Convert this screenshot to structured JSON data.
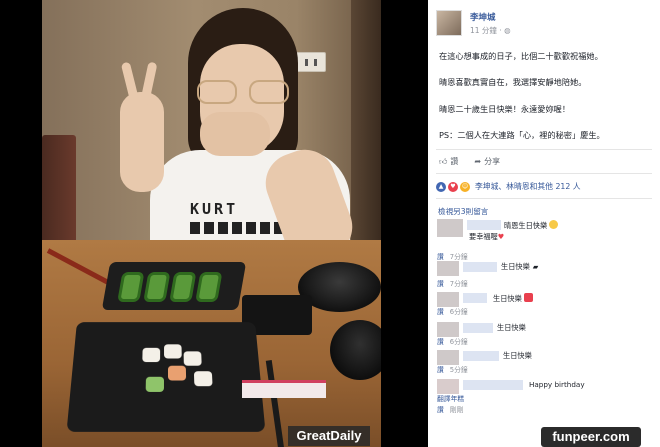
{
  "photo": {
    "shirt_text": "KURT",
    "watermark": "GreatDaily"
  },
  "post": {
    "author": "李坤城",
    "time": "11 分鐘",
    "privacy_icon": "globe-icon",
    "paragraphs": [
      "在這心想事成的日子，比個二十歡歡祝福她。",
      "晴恩喜歡真實自在，我選擇安靜地陪她。",
      "晴恩二十歲生日快樂！永遠愛妳喔！",
      "PS：二個人在大連路「心，裡的秘密」慶生。"
    ],
    "like_label": "讚",
    "share_label": "分享",
    "reactions_text": "李坤城、林晴恩和其他 212 人",
    "reaction_colors": [
      "#4267b2",
      "#e9404e",
      "#f7b125"
    ]
  },
  "comments_header": "檢視另3則留言",
  "comments": [
    {
      "text": "晴恩生日快樂",
      "emoji": "smile-emoji",
      "second_line": "要幸福喔",
      "heart": true,
      "sub_action": "",
      "time": ""
    },
    {
      "text": "",
      "emoji": "",
      "second_line": "",
      "heart": false,
      "sub_action": "讚",
      "time": "7分鐘"
    },
    {
      "text": "生日快樂",
      "emoji": "cake-emoji",
      "second_line": "",
      "heart": false,
      "sub_action": "讚",
      "time": "7分鐘"
    },
    {
      "text": "生日快樂",
      "emoji": "gift-emoji",
      "second_line": "",
      "heart": false,
      "sub_action": "讚",
      "time": "6分鐘"
    },
    {
      "text": "生日快樂",
      "emoji": "",
      "second_line": "",
      "heart": false,
      "sub_action": "讚",
      "time": "6分鐘"
    },
    {
      "text": "生日快樂",
      "emoji": "",
      "second_line": "",
      "heart": false,
      "sub_action": "讚",
      "time": "5分鐘"
    },
    {
      "text": "Happy birthday",
      "emoji": "",
      "second_line": "",
      "heart": false,
      "sub_action": "翻譯年糕",
      "time": ""
    },
    {
      "text": "",
      "emoji": "",
      "second_line": "",
      "heart": false,
      "sub_action": "讚",
      "time": "剛剛"
    }
  ],
  "site_mark": "funpeer.com"
}
